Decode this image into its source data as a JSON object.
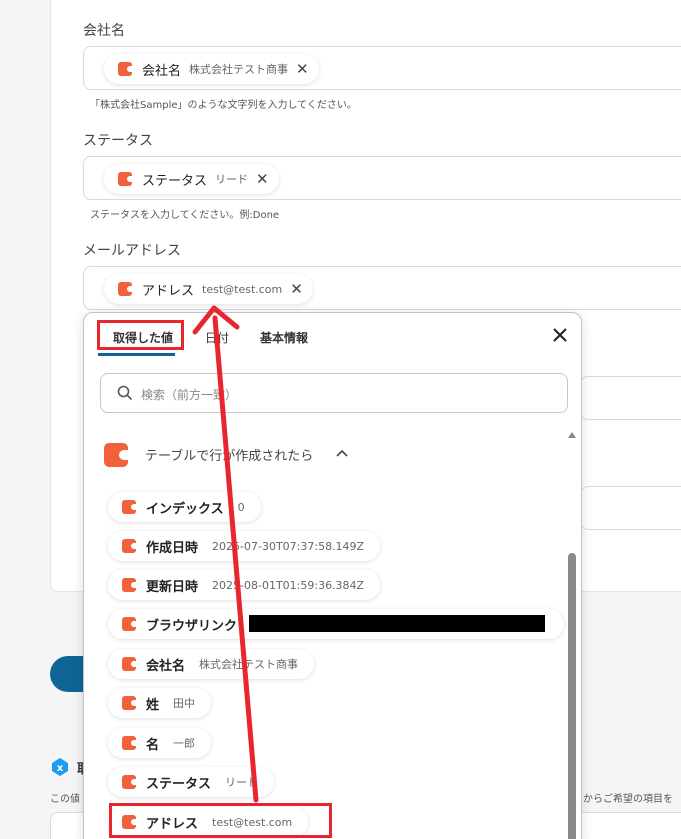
{
  "form": {
    "company": {
      "label": "会社名",
      "tag_name": "会社名",
      "tag_value": "株式会社テスト商事",
      "hint": "「株式会社Sample」のような文字列を入力してください。"
    },
    "status": {
      "label": "ステータス",
      "tag_name": "ステータス",
      "tag_value": "リード",
      "hint": "ステータスを入力してください。例:Done"
    },
    "email": {
      "label": "メールアドレス",
      "tag_name": "アドレス",
      "tag_value": "test@test.com"
    }
  },
  "bottom": {
    "label": "取",
    "hint_left": "この値",
    "hint_right": "からご希望の項目を"
  },
  "popup": {
    "tabs": [
      "取得した値",
      "日付",
      "基本情報"
    ],
    "search_placeholder": "検索（前方一致）",
    "section_title": "テーブルで行が作成されたら",
    "items": [
      {
        "name": "インデックス",
        "value": "0"
      },
      {
        "name": "作成日時",
        "value": "2025-07-30T07:37:58.149Z"
      },
      {
        "name": "更新日時",
        "value": "2025-08-01T01:59:36.384Z"
      },
      {
        "name": "ブラウザリンク",
        "value": ""
      },
      {
        "name": "会社名",
        "value": "株式会社テスト商事"
      },
      {
        "name": "姓",
        "value": "田中"
      },
      {
        "name": "名",
        "value": "一郎"
      },
      {
        "name": "ステータス",
        "value": "リード"
      },
      {
        "name": "アドレス",
        "value": "test@test.com"
      }
    ]
  },
  "colors": {
    "brand": "#f0613c",
    "accent": "#0f6496",
    "annotation": "#e8262f"
  }
}
